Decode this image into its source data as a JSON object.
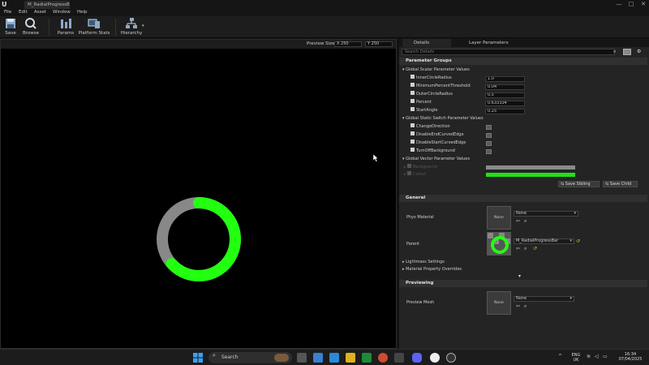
{
  "title_bar": {
    "tab_title": "M_RadialProgressBar_Inst",
    "minimize": "—",
    "maximize": "□",
    "close": "✕"
  },
  "menu": [
    "File",
    "Edit",
    "Asset",
    "Window",
    "Help"
  ],
  "toolbar": {
    "save": "Save",
    "browse": "Browse",
    "params": "Params",
    "platform_stats": "Platform Stats",
    "hierarchy": "Hierarchy"
  },
  "viewport": {
    "preview_size_label": "Preview Size",
    "size_x": "X  250",
    "size_y": "Y  250",
    "ring": {
      "percent": 0.633334,
      "fill_color": "#22ff11",
      "bg_color": "#888888"
    }
  },
  "details": {
    "tabs": [
      "Details",
      "Layer Parameters"
    ],
    "search_placeholder": "Search Details",
    "parameter_groups": "Parameter Groups",
    "scalar_group": "Global Scalar Parameter Values",
    "scalars": [
      {
        "name": "InnerCircleRadius",
        "value": "1.0"
      },
      {
        "name": "MinimumPercentThreshold",
        "value": "0.04"
      },
      {
        "name": "OuterCircleRadius",
        "value": "0.5"
      },
      {
        "name": "Percent",
        "value": "0.633334"
      },
      {
        "name": "StartAngle",
        "value": "0.25"
      }
    ],
    "switch_group": "Global Static Switch Parameter Values",
    "switches": [
      "ChangeDirection",
      "DisableEndCurvedEdge",
      "DisableStartCurvedEdge",
      "TurnOffBackground"
    ],
    "vector_group": "Global Vector Parameter Values",
    "vectors": [
      {
        "name": "Background",
        "color": "#8a8a8a"
      },
      {
        "name": "Colour",
        "color": "#22e016"
      }
    ],
    "save_sibling": "Save Sibling",
    "save_child": "Save Child",
    "general_section": "General",
    "phys_material_label": "Phys Material",
    "phys_material_thumb": "None",
    "phys_material_value": "None",
    "parent_label": "Parent",
    "parent_value": "M_RadialProgressBar",
    "lightmass_settings": "Lightmass Settings",
    "material_property_overrides": "Material Property Overrides",
    "previewing_section": "Previewing",
    "preview_mesh_label": "Preview Mesh",
    "preview_mesh_thumb": "None",
    "preview_mesh_value": "None"
  },
  "taskbar": {
    "search_label": "Search",
    "lang_top": "ENG",
    "lang_bottom": "UK",
    "time": "16:34",
    "date": "07/04/2025"
  }
}
